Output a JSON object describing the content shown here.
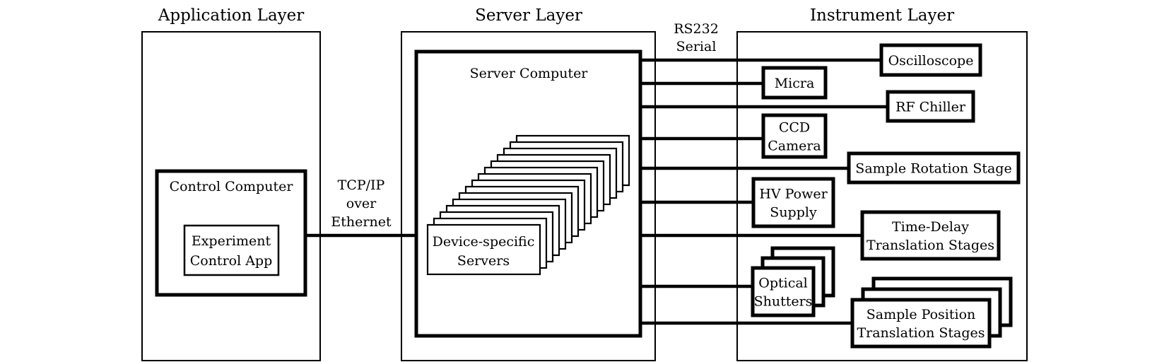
{
  "layers": {
    "application": "Application Layer",
    "server": "Server Layer",
    "instrument": "Instrument Layer"
  },
  "application": {
    "control_computer": "Control Computer",
    "app_lines": [
      "Experiment",
      "Control App"
    ]
  },
  "links": {
    "tcp_lines": [
      "TCP/IP",
      "over",
      "Ethernet"
    ],
    "serial_lines": [
      "RS232",
      "Serial"
    ]
  },
  "server": {
    "server_computer": "Server Computer",
    "device_servers_lines": [
      "Device-specific",
      "Servers"
    ],
    "device_server_stack_count": 15
  },
  "instruments": [
    {
      "lines": [
        "Oscilloscope"
      ],
      "stack": 1
    },
    {
      "lines": [
        "Micra"
      ],
      "stack": 1
    },
    {
      "lines": [
        "RF Chiller"
      ],
      "stack": 1
    },
    {
      "lines": [
        "CCD",
        "Camera"
      ],
      "stack": 1
    },
    {
      "lines": [
        "Sample Rotation Stage"
      ],
      "stack": 1
    },
    {
      "lines": [
        "HV Power",
        "Supply"
      ],
      "stack": 1
    },
    {
      "lines": [
        "Time-Delay",
        "Translation Stages"
      ],
      "stack": 1
    },
    {
      "lines": [
        "Optical",
        "Shutters"
      ],
      "stack": 3
    },
    {
      "lines": [
        "Sample Position",
        "Translation Stages"
      ],
      "stack": 3
    }
  ]
}
